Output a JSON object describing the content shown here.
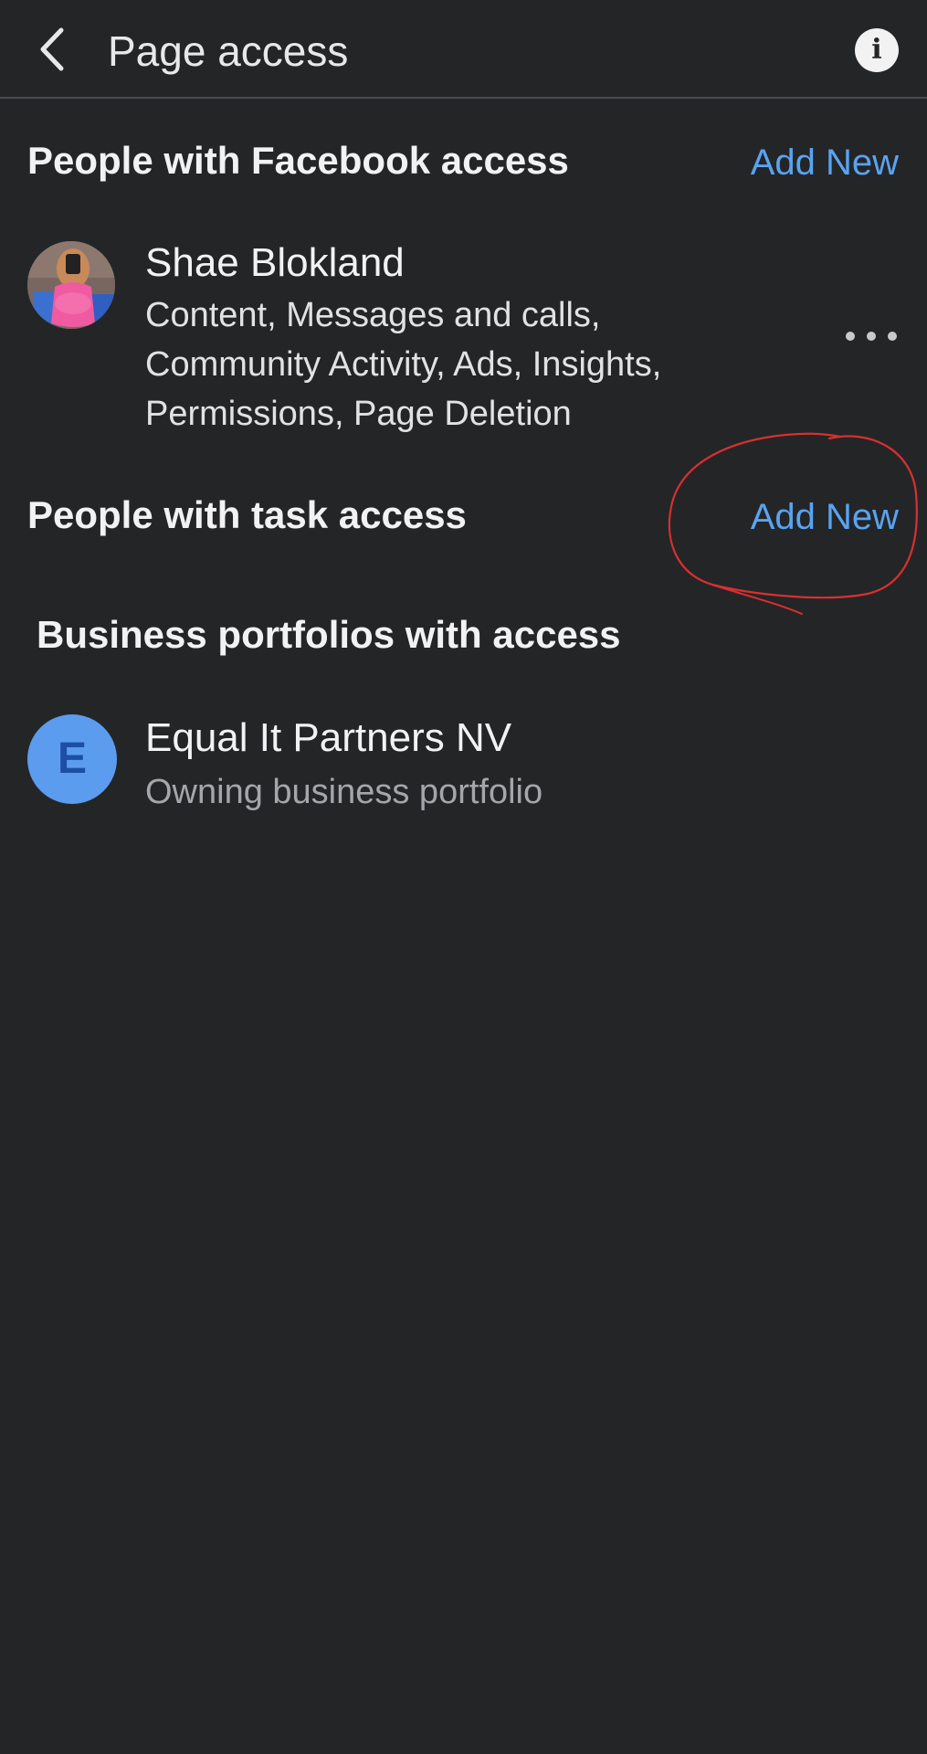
{
  "header": {
    "title": "Page access"
  },
  "facebook_access": {
    "heading": "People with Facebook access",
    "add_label": "Add New",
    "people": [
      {
        "name": "Shae Blokland",
        "permissions": "Content, Messages and calls, Community Activity, Ads, Insights, Permissions, Page Deletion"
      }
    ]
  },
  "task_access": {
    "heading": "People with task access",
    "add_label": "Add New"
  },
  "business_portfolios": {
    "heading": "Business portfolios with access",
    "items": [
      {
        "initial": "E",
        "name": "Equal It Partners NV",
        "subtitle": "Owning business portfolio"
      }
    ]
  },
  "colors": {
    "background": "#242527",
    "accent_link": "#5aa3f0",
    "annotation": "#d8302f",
    "business_avatar": "#5b9cef"
  },
  "icons": {
    "back": "chevron-left-icon",
    "info": "info-icon",
    "more": "more-horizontal-icon"
  }
}
